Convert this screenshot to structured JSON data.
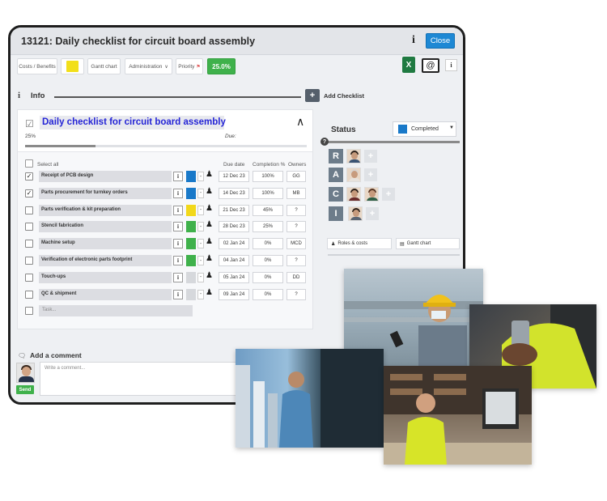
{
  "window": {
    "title": "13121: Daily checklist for circuit board assembly",
    "close_label": "Close",
    "info_glyph": "i"
  },
  "toolbar": {
    "costs_benefits": "Costs / Benefits",
    "gantt_chart": "Gantt chart",
    "administration": "Administration",
    "priority": "Priority",
    "priority_value": "25.0%"
  },
  "info_section": {
    "label": "Info",
    "add_checklist": "Add Checklist"
  },
  "checklist": {
    "title": "Daily checklist for circuit board assembly",
    "percent": "25%",
    "percent_value": 25,
    "due_label": "Due:",
    "select_all": "Select all",
    "columns": {
      "due_date": "Due date",
      "completion": "Completion %",
      "owners": "Owners"
    },
    "rows": [
      {
        "name": "Receipt of PCB design",
        "checked": true,
        "color": "#1979c9",
        "due": "12 Dec 23",
        "completion": "100%",
        "owner": "GG"
      },
      {
        "name": "Parts procurement for turnkey orders",
        "checked": true,
        "color": "#1979c9",
        "due": "14 Dec 23",
        "completion": "100%",
        "owner": "MB"
      },
      {
        "name": "Parts verification & kit preparation",
        "checked": false,
        "color": "#f2d81a",
        "due": "21 Dec 23",
        "completion": "45%",
        "owner": "?"
      },
      {
        "name": "Stencil fabrication",
        "checked": false,
        "color": "#3fb14b",
        "due": "28 Dec 23",
        "completion": "25%",
        "owner": "?"
      },
      {
        "name": "Machine setup",
        "checked": false,
        "color": "#3fb14b",
        "due": "02 Jan 24",
        "completion": "0%",
        "owner": "MCD"
      },
      {
        "name": "Verification of electronic parts footprint",
        "checked": false,
        "color": "#3fb14b",
        "due": "04 Jan 24",
        "completion": "0%",
        "owner": "?"
      },
      {
        "name": "Touch-ups",
        "checked": false,
        "color": "#d6d8dc",
        "due": "05 Jan 24",
        "completion": "0%",
        "owner": "DD"
      },
      {
        "name": "QC & shipment",
        "checked": false,
        "color": "#d6d8dc",
        "due": "09 Jan 24",
        "completion": "0%",
        "owner": "?"
      }
    ],
    "new_task_placeholder": "Task..."
  },
  "status": {
    "label": "Status",
    "value": "Completed",
    "color": "#1979c9",
    "raci": [
      "R",
      "A",
      "C",
      "I"
    ],
    "roles_costs": "Roles & costs",
    "gantt_chart": "Gantt chart"
  },
  "comment": {
    "label": "Add a comment",
    "placeholder": "Write a comment...",
    "send": "Send"
  }
}
